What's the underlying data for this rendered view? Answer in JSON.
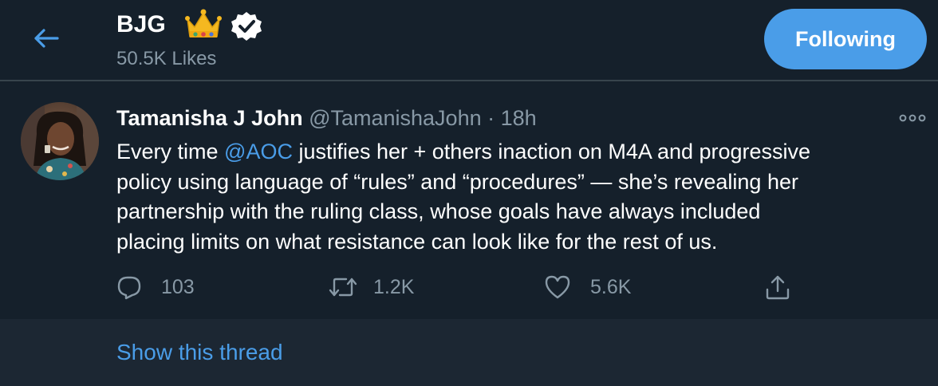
{
  "header": {
    "profile_name": "BJG",
    "crown_emoji": "crown-icon",
    "verified_icon": "verified-badge-icon",
    "likes": "50.5K Likes",
    "follow_button": "Following"
  },
  "tweet": {
    "author_name": "Tamanisha J John",
    "author_handle": "@TamanishaJohn",
    "separator": "·",
    "time": "18h",
    "body": {
      "line1_before": "Every time ",
      "mention": "@AOC",
      "line1_after": " justifies her + others inaction on M4A and progressive",
      "line2": "policy using language of “rules” and “procedures” — she’s revealing her",
      "line3": "partnership with the ruling class, whose goals have always included",
      "line4": "placing limits on what resistance can look like for the rest of us."
    },
    "actions": {
      "replies": "103",
      "retweets": "1.2K",
      "likes": "5.6K"
    }
  },
  "thread": {
    "link": "Show this thread"
  },
  "colors": {
    "background": "#15202b",
    "thread_background": "#1c2733",
    "accent": "#4a9de8",
    "muted": "#8899a6",
    "divider": "#38444d"
  }
}
